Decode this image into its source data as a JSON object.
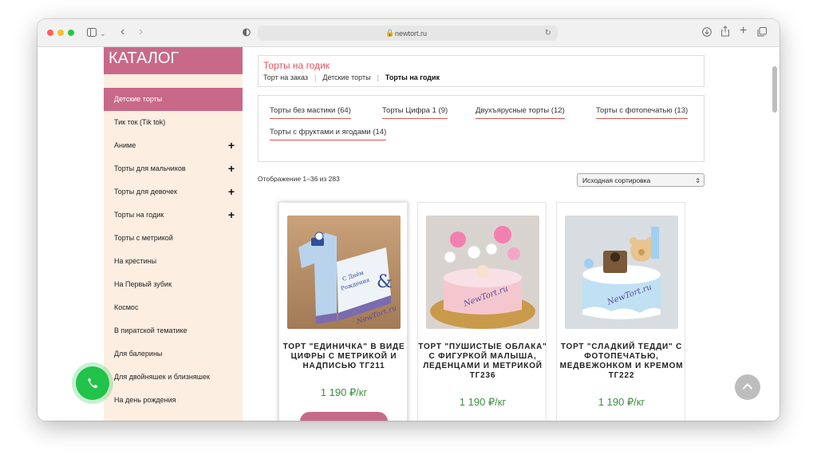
{
  "browser": {
    "url": "newtort.ru",
    "colors": {
      "close": "#ff5f57",
      "minimize": "#febc2e",
      "maximize": "#28c840"
    },
    "icons": [
      "sidebar-toggle-icon",
      "chevron-down-icon",
      "back-icon",
      "forward-icon",
      "shield-icon",
      "lock-icon",
      "reload-icon",
      "download-icon",
      "share-icon",
      "new-tab-icon",
      "tabs-overview-icon"
    ]
  },
  "sidebar": {
    "title": "КАТАЛОГ",
    "items": [
      {
        "label": "Детские торты",
        "active": true,
        "expandable": false
      },
      {
        "label": "Тик ток (Tik tok)",
        "active": false,
        "expandable": false
      },
      {
        "label": "Аниме",
        "active": false,
        "expandable": true
      },
      {
        "label": "Торты для мальчиков",
        "active": false,
        "expandable": true
      },
      {
        "label": "Торты для девочек",
        "active": false,
        "expandable": true
      },
      {
        "label": "Торты на годик",
        "active": false,
        "expandable": true
      },
      {
        "label": "Торты с метрикой",
        "active": false,
        "expandable": false
      },
      {
        "label": "На крестины",
        "active": false,
        "expandable": false
      },
      {
        "label": "На Первый зубик",
        "active": false,
        "expandable": false
      },
      {
        "label": "Космос",
        "active": false,
        "expandable": false
      },
      {
        "label": "В пиратской тематике",
        "active": false,
        "expandable": false
      },
      {
        "label": "Для балерины",
        "active": false,
        "expandable": false
      },
      {
        "label": "Для двойняшек и близняшек",
        "active": false,
        "expandable": false
      },
      {
        "label": "На день рождения",
        "active": false,
        "expandable": false
      }
    ],
    "plus_glyph": "+"
  },
  "breadcrumb": {
    "title": "Торты на годик",
    "links": [
      "Торт на заказ",
      "Детские торты"
    ],
    "current": "Торты на годик",
    "separator": "|"
  },
  "subcategories": [
    {
      "label": "Торты без мастики",
      "count": "(64)"
    },
    {
      "label": "Торты Цифра 1",
      "count": "(9)"
    },
    {
      "label": "Двухъярусные торты",
      "count": "(12)"
    },
    {
      "label": "Торты с фотопечатью",
      "count": "(13)"
    },
    {
      "label": "Торты с фруктами и ягодами",
      "count": "(14)"
    }
  ],
  "listing": {
    "showing": "Отображение 1–36 из 283",
    "sort": "Исходная сортировка"
  },
  "products": [
    {
      "name": "Торт \"Единичка\" в виде цифры с метрикой и надписью ТГ211",
      "price": "1 190 ₽/кг",
      "watermark": "NewTort.ru"
    },
    {
      "name": "Торт \"Пушистые облака\" с фигуркой малыша, леденцами и метрикой ТГ236",
      "price": "1 190 ₽/кг",
      "watermark": "NewTort.ru"
    },
    {
      "name": "Торт \"Сладкий Тедди\" с фотопечатью, медвежонком и кремом ТГ222",
      "price": "1 190 ₽/кг",
      "watermark": "NewTort.ru"
    }
  ],
  "floating": {
    "call_icon": "phone-icon",
    "up_icon": "arrow-up-icon"
  }
}
